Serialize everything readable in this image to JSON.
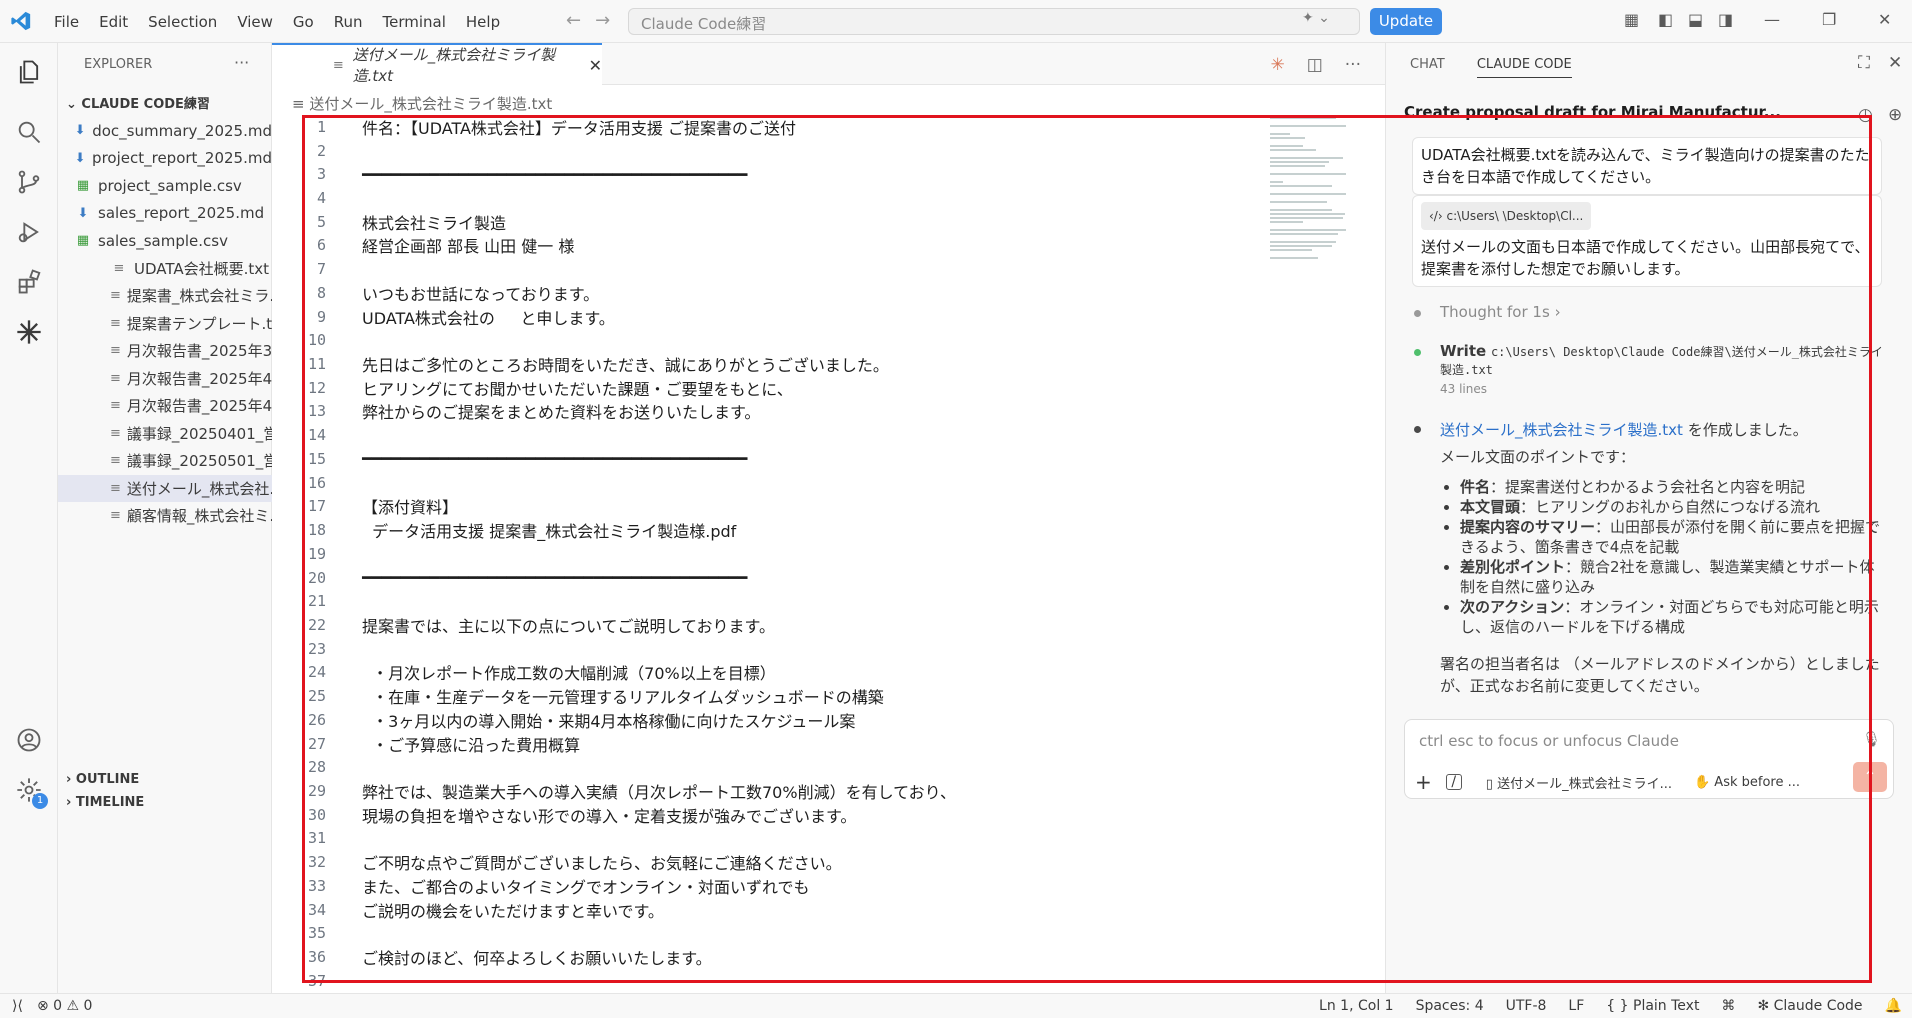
{
  "titlebar": {
    "menu": [
      "File",
      "Edit",
      "Selection",
      "View",
      "Go",
      "Run",
      "Terminal",
      "Help"
    ],
    "search_text": "Claude Code練習",
    "update_label": "Update"
  },
  "sidebar": {
    "title": "EXPLORER",
    "folder": "CLAUDE CODE練習",
    "files": [
      {
        "name": "doc_summary_2025.md",
        "type": "md"
      },
      {
        "name": "project_report_2025.md",
        "type": "md"
      },
      {
        "name": "project_sample.csv",
        "type": "csv"
      },
      {
        "name": "sales_report_2025.md",
        "type": "md"
      },
      {
        "name": "sales_sample.csv",
        "type": "csv"
      },
      {
        "name": "UDATA会社概要.txt",
        "type": "txt"
      },
      {
        "name": "提案書_株式会社ミラ...",
        "type": "txt"
      },
      {
        "name": "提案書テンプレート.txt",
        "type": "txt"
      },
      {
        "name": "月次報告書_2025年3...",
        "type": "txt"
      },
      {
        "name": "月次報告書_2025年4...",
        "type": "txt"
      },
      {
        "name": "月次報告書_2025年4...",
        "type": "txt"
      },
      {
        "name": "議事録_20250401_営...",
        "type": "txt"
      },
      {
        "name": "議事録_20250501_営...",
        "type": "txt"
      },
      {
        "name": "送付メール_株式会社...",
        "type": "txt",
        "selected": true
      },
      {
        "name": "顧客情報_株式会社ミ...",
        "type": "txt"
      }
    ],
    "outline": "OUTLINE",
    "timeline": "TIMELINE",
    "badge": "1"
  },
  "editor": {
    "tab_label": "送付メール_株式会社ミライ製造.txt",
    "breadcrumb": "送付メール_株式会社ミライ製造.txt",
    "lines": [
      "件名：【UDATA株式会社】データ活用支援 ご提案書のご送付",
      "",
      "━━━━━━━━━━━━━━━━━━━━━━━━━━━━━━━━━━━━━━━━",
      "",
      "株式会社ミライ製造",
      "経営企画部 部長 山田 健一 様",
      "",
      "いつもお世話になっております。",
      "UDATA株式会社の     と申します。",
      "",
      "先日はご多忙のところお時間をいただき、誠にありがとうございました。",
      "ヒアリングにてお聞かせいただいた課題・ご要望をもとに、",
      "弊社からのご提案をまとめた資料をお送りいたします。",
      "",
      "━━━━━━━━━━━━━━━━━━━━━━━━━━━━━━━━━━━━━━━━",
      "",
      "【添付資料】",
      "  データ活用支援 提案書_株式会社ミライ製造様.pdf",
      "",
      "━━━━━━━━━━━━━━━━━━━━━━━━━━━━━━━━━━━━━━━━",
      "",
      "提案書では、主に以下の点についてご説明しております。",
      "",
      "  ・月次レポート作成工数の大幅削減（70%以上を目標）",
      "  ・在庫・生産データを一元管理するリアルタイムダッシュボードの構築",
      "  ・3ヶ月以内の導入開始・来期4月本格稼働に向けたスケジュール案",
      "  ・ご予算感に沿った費用概算",
      "",
      "弊社では、製造業大手への導入実績（月次レポート工数70%削減）を有しており、",
      "現場の負担を増やさない形での導入・定着支援が強みでございます。",
      "",
      "ご不明な点やご質問がございましたら、お気軽にご連絡ください。",
      "また、ご都合のよいタイミングでオンライン・対面いずれでも",
      "ご説明の機会をいただけますと幸いです。",
      "",
      "ご検討のほど、何卒よろしくお願いいたします。",
      ""
    ]
  },
  "chat": {
    "tab_chat": "CHAT",
    "tab_claude": "CLAUDE CODE",
    "title": "Create proposal draft for Mirai Manufactur...",
    "msg1": "UDATA会社概要.txtを読み込んで、ミライ製造向けの提案書のたたき台を日本語で作成してください。",
    "msg2_chip": "c:\\Users\\        \\Desktop\\Cl...",
    "msg2": "送付メールの文面も日本語で作成してください。山田部長宛てで、提案書を添付した想定でお願いします。",
    "thought": "Thought for 1s",
    "write_label": "Write",
    "write_path": "c:\\Users\\        Desktop\\Claude Code練習\\送付メール_株式会社ミライ製造.txt",
    "write_lines": "43 lines",
    "result_link": "送付メール_株式会社ミライ製造.txt",
    "result_suffix": " を作成しました。",
    "points_intro": "メール文面のポイントです：",
    "points": [
      {
        "bold": "件名",
        "text": "：提案書送付とわかるよう会社名と内容を明記"
      },
      {
        "bold": "本文冒頭",
        "text": "：ヒアリングのお礼から自然につなげる流れ"
      },
      {
        "bold": "提案内容のサマリー",
        "text": "：山田部長が添付を開く前に要点を把握できるよう、箇条書きで4点を記載"
      },
      {
        "bold": "差別化ポイント",
        "text": "：競合2社を意識し、製造業実績とサポート体制を自然に盛り込み"
      },
      {
        "bold": "次のアクション",
        "text": "：オンライン・対面どちらでも対応可能と明示し、返信のハードルを下げる構成"
      }
    ],
    "signature_note": "署名の担当者名は       （メールアドレスのドメインから）としましたが、正式なお名前に変更してください。",
    "input_placeholder": "ctrl esc to focus or unfocus Claude",
    "input_file": "送付メール_株式会社ミライ...",
    "input_mode": "Ask before ..."
  },
  "status": {
    "errors": "0",
    "warnings": "0",
    "position": "Ln 1, Col 1",
    "spaces": "Spaces: 4",
    "encoding": "UTF-8",
    "eol": "LF",
    "language": "Plain Text",
    "claude": "Claude Code"
  },
  "colors": {
    "accent": "#3c8be6",
    "highlight": "#e1141e"
  }
}
